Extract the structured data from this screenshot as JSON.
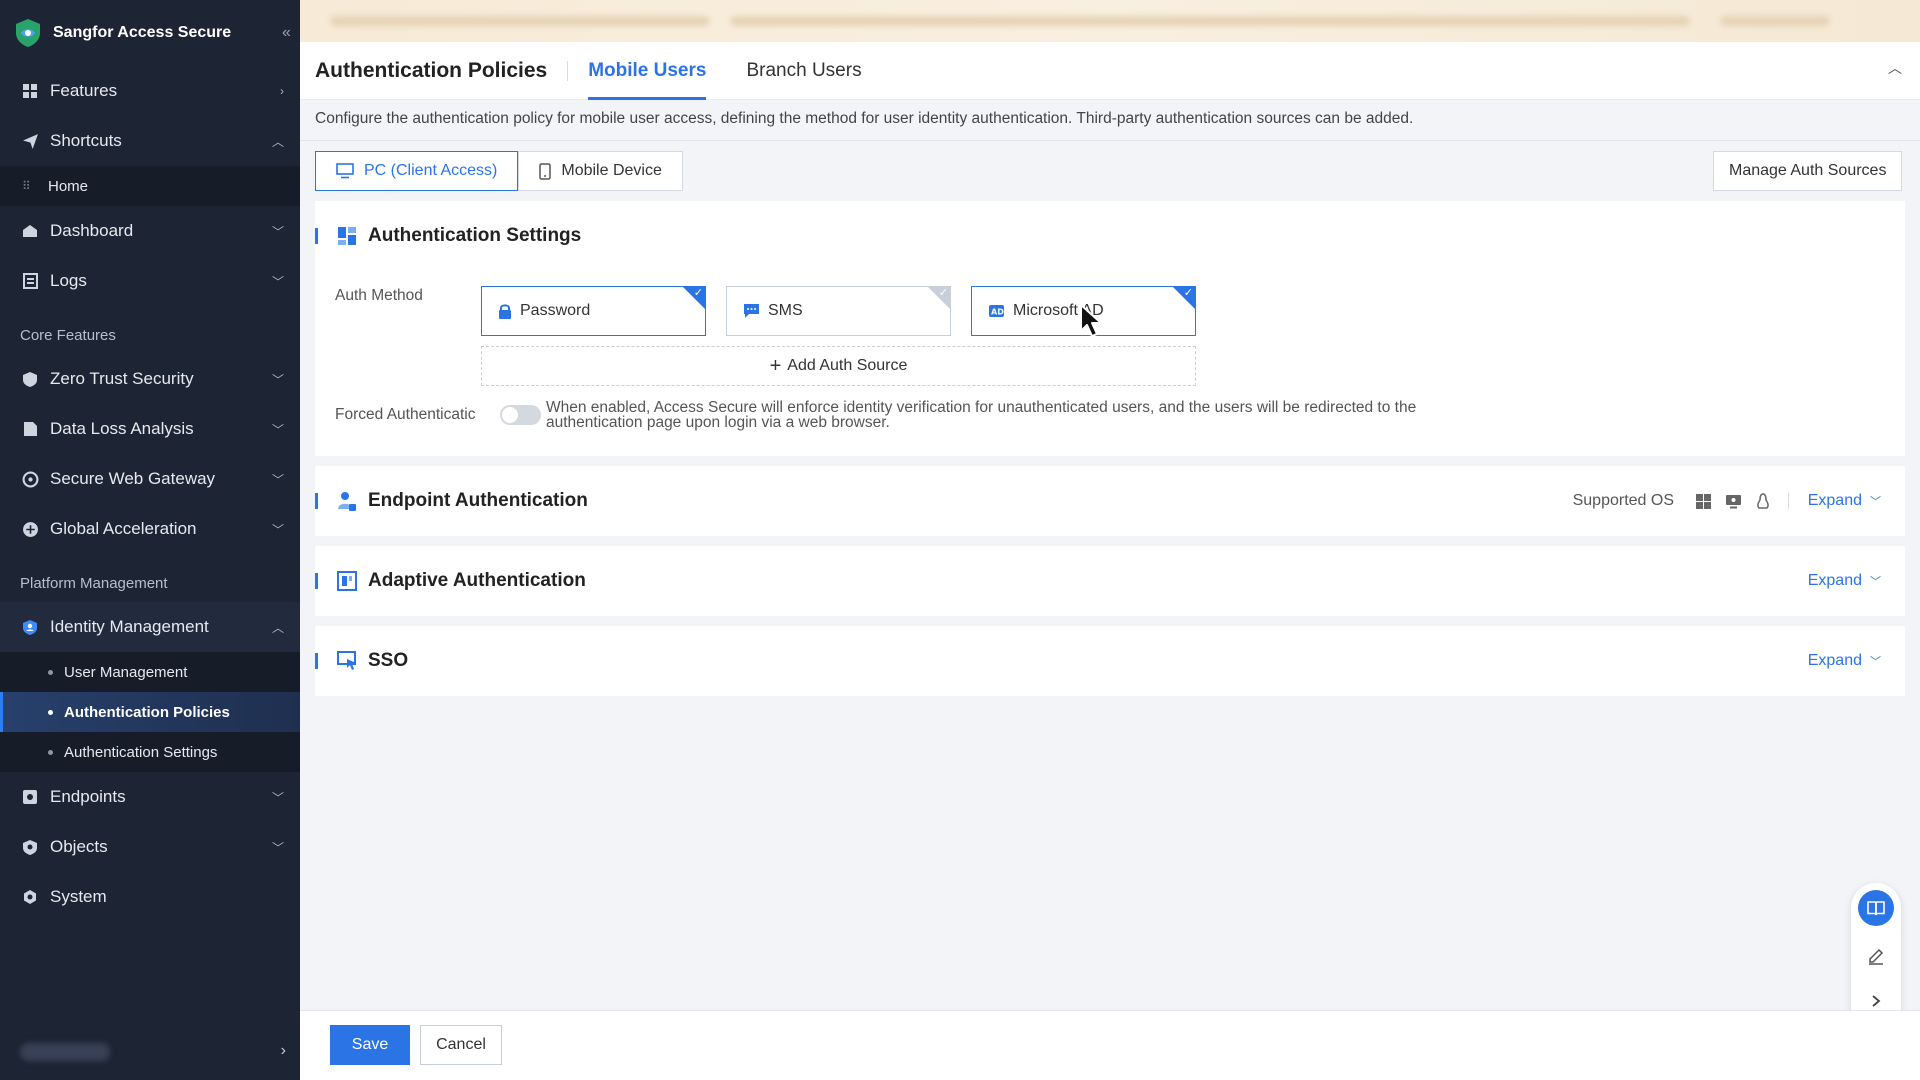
{
  "sidebar": {
    "brand": "Sangfor Access Secure",
    "collapse_icon": "double-chevron-left-icon",
    "items": [
      {
        "label": "Features",
        "icon": "grid-icon"
      },
      {
        "label": "Shortcuts",
        "icon": "send-icon"
      },
      {
        "label": "Home"
      },
      {
        "label": "Dashboard",
        "icon": "dashboard-icon"
      },
      {
        "label": "Logs",
        "icon": "logs-icon"
      }
    ],
    "group_core": "Core Features",
    "core_items": [
      {
        "label": "Zero Trust Security",
        "icon": "shield-icon"
      },
      {
        "label": "Data Loss Analysis",
        "icon": "data-icon"
      },
      {
        "label": "Secure Web Gateway",
        "icon": "gateway-icon"
      },
      {
        "label": "Global Acceleration",
        "icon": "acceleration-icon"
      }
    ],
    "group_platform": "Platform Management",
    "identity": {
      "label": "Identity Management",
      "icon": "identity-icon"
    },
    "identity_children": [
      {
        "label": "User Management"
      },
      {
        "label": "Authentication Policies",
        "active": true
      },
      {
        "label": "Authentication Settings"
      }
    ],
    "bottom_items": [
      {
        "label": "Endpoints",
        "icon": "endpoint-icon"
      },
      {
        "label": "Objects",
        "icon": "objects-icon"
      },
      {
        "label": "System",
        "icon": "system-icon"
      }
    ]
  },
  "header": {
    "title": "Authentication Policies",
    "tabs": [
      {
        "label": "Mobile Users",
        "active": true
      },
      {
        "label": "Branch Users",
        "active": false
      }
    ]
  },
  "description": "Configure the authentication policy for mobile user access, defining the method for user identity authentication. Third-party authentication sources can be added.",
  "device_tabs": [
    {
      "label": "PC (Client Access)",
      "icon": "monitor-icon",
      "active": true
    },
    {
      "label": "Mobile Device",
      "icon": "phone-icon",
      "active": false
    }
  ],
  "manage_auth_sources": "Manage Auth Sources",
  "auth_settings": {
    "title": "Authentication Settings",
    "auth_method_label": "Auth Method",
    "methods": [
      {
        "label": "Password",
        "icon": "lock-icon",
        "selected": true
      },
      {
        "label": "SMS",
        "icon": "message-icon",
        "selected": false
      },
      {
        "label": "Microsoft AD",
        "icon": "ad-icon",
        "selected": true
      }
    ],
    "add_source": "Add Auth Source",
    "forced_label": "Forced Authenticatic",
    "forced_enabled": false,
    "forced_desc": "When enabled, Access Secure will enforce identity verification for unauthenticated users, and the users will be redirected to the authentication page upon login via a web browser."
  },
  "endpoint_auth": {
    "title": "Endpoint Authentication",
    "supported_os": "Supported OS",
    "expand": "Expand"
  },
  "adaptive_auth": {
    "title": "Adaptive Authentication",
    "expand": "Expand"
  },
  "sso": {
    "title": "SSO",
    "expand": "Expand"
  },
  "footer": {
    "save": "Save",
    "cancel": "Cancel"
  },
  "colors": {
    "accent": "#2b74e6",
    "sidebar_bg": "#1d2433"
  }
}
